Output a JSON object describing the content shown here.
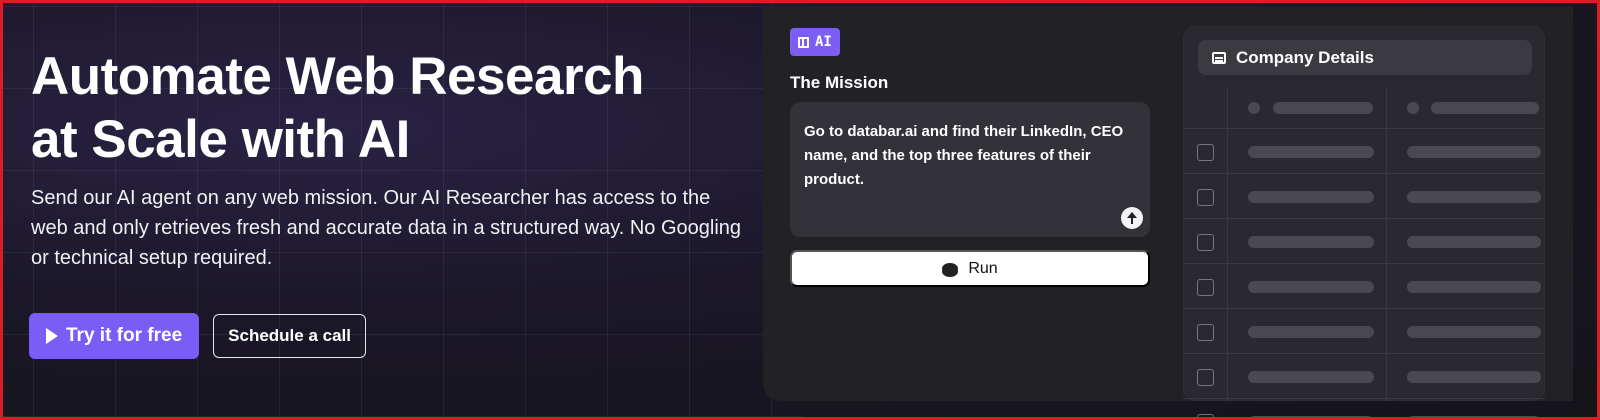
{
  "hero": {
    "title_line1": "Automate Web Research",
    "title_line2": "at Scale with AI",
    "subtitle": "Send our AI agent on any web mission. Our AI Researcher has access to the web and only retrieves fresh and accurate data in a structured way. No Googling or technical setup required.",
    "primary_cta": "Try it for free",
    "secondary_cta": "Schedule a call"
  },
  "demo": {
    "badge_label": "AI",
    "badge_icon": "map-icon",
    "mission_label": "The Mission",
    "mission_text": "Go to databar.ai and find their LinkedIn, CEO name, and the top three features of their product.",
    "run_label": "Run"
  },
  "table": {
    "title": "Company Details",
    "row_count": 7
  },
  "colors": {
    "accent": "#7a5cf6",
    "border": "#d81f26",
    "panel": "#222126"
  }
}
